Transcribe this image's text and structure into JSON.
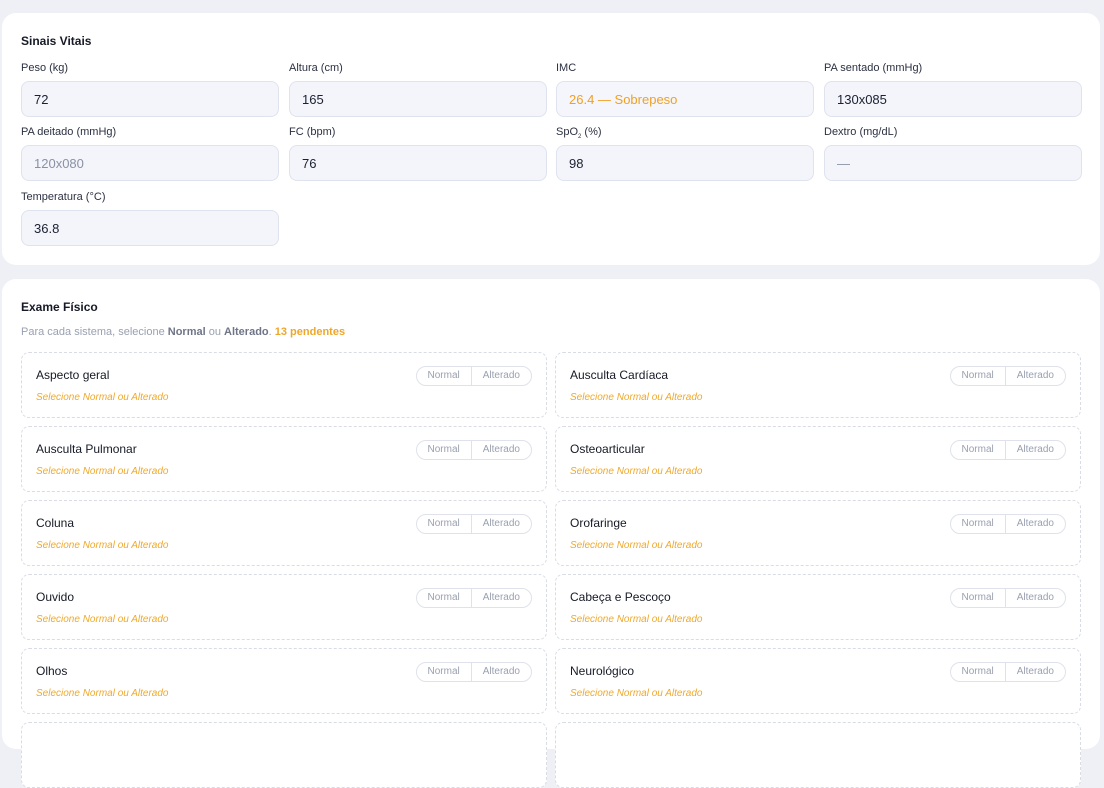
{
  "vitals": {
    "title": "Sinais Vitais",
    "fields": [
      {
        "label": "Peso (kg)",
        "value": "72",
        "style": "normal"
      },
      {
        "label": "Altura (cm)",
        "value": "165",
        "style": "normal"
      },
      {
        "label": "IMC",
        "value": "26.4 — Sobrepeso",
        "style": "warn"
      },
      {
        "label": "PA sentado (mmHg)",
        "value": "130x085",
        "style": "normal"
      },
      {
        "label": "PA deitado (mmHg)",
        "placeholder": "120x080",
        "style": "muted"
      },
      {
        "label": "FC (bpm)",
        "value": "76",
        "style": "normal"
      },
      {
        "label": "SpO",
        "label_sub": "2",
        "label_suffix": " (%)",
        "value": "98",
        "style": "normal"
      },
      {
        "label": "Dextro (mg/dL)",
        "placeholder": "—",
        "style": "muted"
      },
      {
        "label": "Temperatura (°C)",
        "value": "36.8",
        "style": "normal"
      }
    ]
  },
  "exam": {
    "title": "Exame Físico",
    "hint_prefix": "Para cada sistema, selecione ",
    "hint_normal": "Normal",
    "hint_or": " ou ",
    "hint_altered": "Alterado",
    "hint_dot": ". ",
    "hint_pending": "13 pendentes",
    "toggle_normal": "Normal",
    "toggle_altered": "Alterado",
    "note": "Selecione Normal ou Alterado",
    "systems": [
      "Aspecto geral",
      "Ausculta Cardíaca",
      "Ausculta Pulmonar",
      "Osteoarticular",
      "Coluna",
      "Orofaringe",
      "Ouvido",
      "Cabeça e Pescoço",
      "Olhos",
      "Neurológico",
      "",
      ""
    ]
  }
}
